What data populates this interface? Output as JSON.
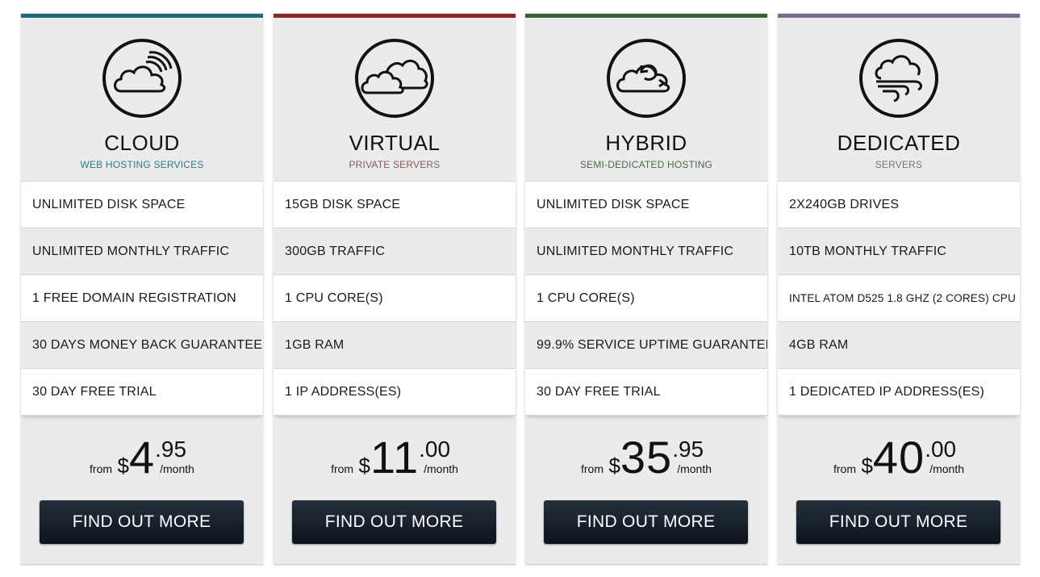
{
  "plans": [
    {
      "icon": "cloud-wifi-icon",
      "title": "CLOUD",
      "subtitle": "WEB HOSTING SERVICES",
      "accent": "#1c6b7d",
      "subtitle_color": "#2d7a8a",
      "features": [
        "UNLIMITED DISK SPACE",
        "UNLIMITED MONTHLY TRAFFIC",
        "1 FREE DOMAIN REGISTRATION",
        "30 DAYS MONEY BACK GUARANTEE",
        "30 DAY FREE TRIAL"
      ],
      "price": {
        "from": "from",
        "currency": "$",
        "integer": "4",
        "decimal": ".95",
        "period": "/month"
      },
      "button": "FIND OUT MORE"
    },
    {
      "icon": "double-cloud-icon",
      "title": "VIRTUAL",
      "subtitle": "PRIVATE SERVERS",
      "accent": "#8b2a22",
      "subtitle_color": "#8a5a55",
      "features": [
        "15GB DISK SPACE",
        "300GB TRAFFIC",
        "1 CPU CORE(S)",
        "1GB RAM",
        "1 IP ADDRESS(ES)"
      ],
      "price": {
        "from": "from",
        "currency": "$",
        "integer": "11",
        "decimal": ".00",
        "period": "/month"
      },
      "button": "FIND OUT MORE"
    },
    {
      "icon": "cloud-sync-icon",
      "title": "HYBRID",
      "subtitle": "SEMI-DEDICATED HOSTING",
      "accent": "#3f5e3c",
      "subtitle_color": "#4d6a48",
      "features": [
        "UNLIMITED DISK SPACE",
        "UNLIMITED MONTHLY TRAFFIC",
        "1 CPU CORE(S)",
        "99.9% SERVICE UPTIME GUARANTEE",
        "30 DAY FREE TRIAL"
      ],
      "price": {
        "from": "from",
        "currency": "$",
        "integer": "35",
        "decimal": ".95",
        "period": "/month"
      },
      "button": "FIND OUT MORE"
    },
    {
      "icon": "cloud-wind-icon",
      "title": "DEDICATED",
      "subtitle": "SERVERS",
      "accent": "#7b6a8c",
      "subtitle_color": "#7a6f82",
      "features": [
        "2X240GB DRIVES",
        "10TB MONTHLY TRAFFIC",
        "INTEL ATOM D525 1.8 GHZ (2 CORES) CPU",
        "4GB RAM",
        "1 DEDICATED IP ADDRESS(ES)"
      ],
      "price": {
        "from": "from",
        "currency": "$",
        "integer": "40",
        "decimal": ".00",
        "period": "/month"
      },
      "button": "FIND OUT MORE"
    }
  ]
}
